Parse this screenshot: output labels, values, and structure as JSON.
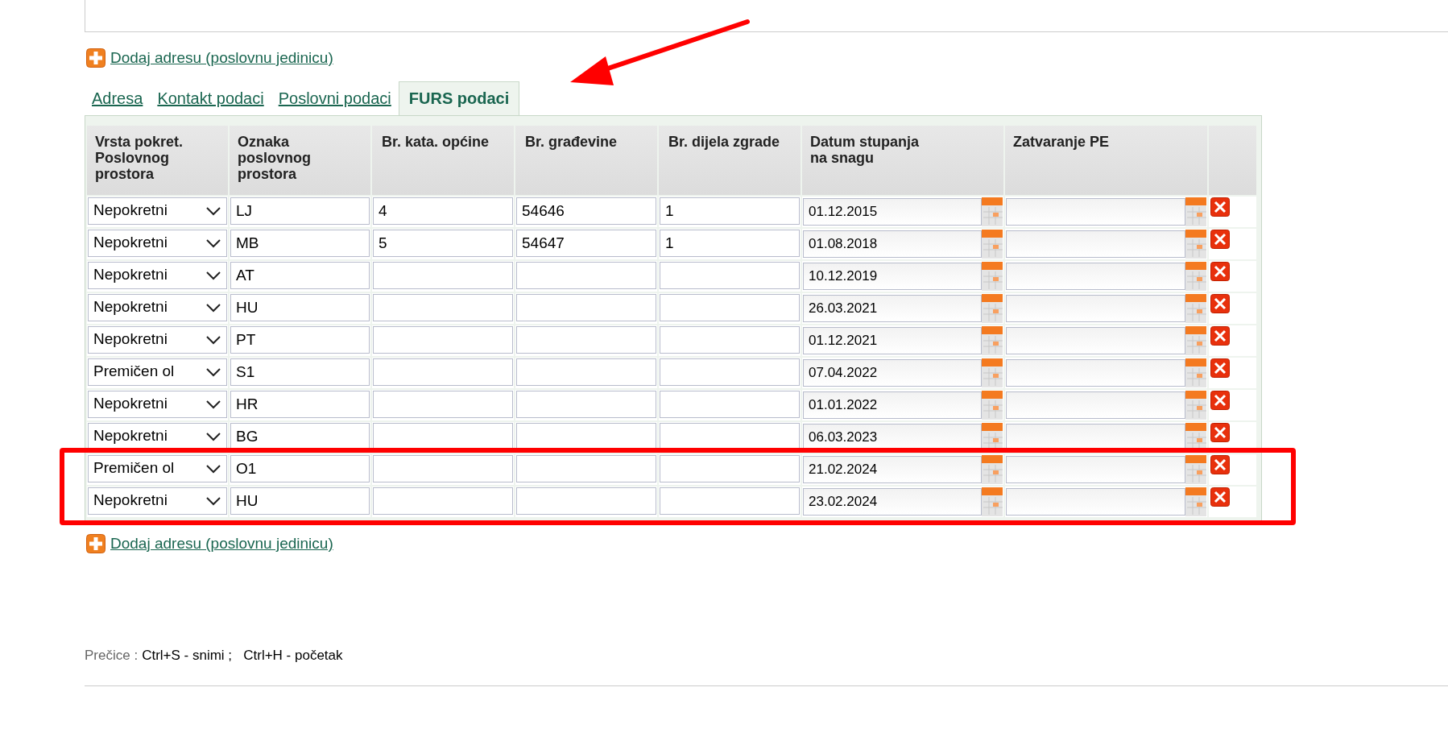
{
  "add_link_top": "Dodaj adresu (poslovnu jedinicu)",
  "tabs": [
    {
      "label": "Adresa",
      "selected": false
    },
    {
      "label": "Kontakt podaci",
      "selected": false
    },
    {
      "label": "Poslovni podaci",
      "selected": false
    },
    {
      "label": "FURS podaci",
      "selected": true
    }
  ],
  "table": {
    "columns": [
      "Vrsta pokret. Poslovnog prostora",
      "Oznaka poslovnog prostora",
      "Br. kata. općine",
      "Br. građevine",
      "Br. dijela zgrade",
      "Datum stupanja na snagu",
      "Zatvaranje PE"
    ],
    "rows": [
      {
        "type": "Nepokretni",
        "code": "LJ",
        "cadastral": "4",
        "building": "54646",
        "part": "1",
        "valid_from": "01.12.2015",
        "highlighted": false
      },
      {
        "type": "Nepokretni",
        "code": "MB",
        "cadastral": "5",
        "building": "54647",
        "part": "1",
        "valid_from": "01.08.2018",
        "highlighted": false
      },
      {
        "type": "Nepokretni",
        "code": "AT",
        "valid_from": "10.12.2019",
        "highlighted": false
      },
      {
        "type": "Nepokretni",
        "code": "HU",
        "valid_from": "26.03.2021",
        "highlighted": false
      },
      {
        "type": "Nepokretni",
        "code": "PT",
        "valid_from": "01.12.2021",
        "highlighted": false
      },
      {
        "type": "Premičen ol",
        "code": "S1",
        "valid_from": "07.04.2022",
        "highlighted": false
      },
      {
        "type": "Nepokretni",
        "code": "HR",
        "valid_from": "01.01.2022",
        "highlighted": false
      },
      {
        "type": "Nepokretni",
        "code": "BG",
        "valid_from": "06.03.2023",
        "highlighted": false
      },
      {
        "type": "Premičen ol",
        "code": "O1",
        "valid_from": "21.02.2024",
        "highlighted": true
      },
      {
        "type": "Nepokretni",
        "code": "HU",
        "valid_from": "23.02.2024",
        "highlighted": true
      }
    ]
  },
  "add_link_bottom": "Dodaj adresu (poslovnu jedinicu)",
  "shortcuts": {
    "label": "Prečice :",
    "text": "Ctrl+S - snimi ;   Ctrl+H - početak"
  }
}
